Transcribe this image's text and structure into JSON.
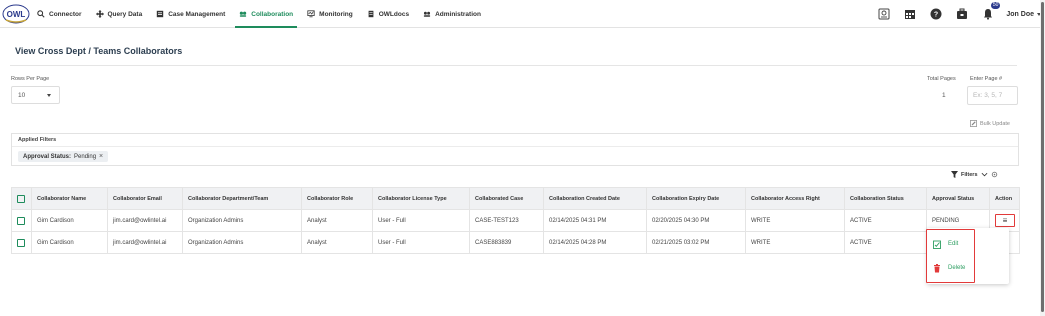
{
  "header": {
    "logo_text": "OWL",
    "nav": [
      {
        "label": "Connector",
        "icon": "search-icon"
      },
      {
        "label": "Query Data",
        "icon": "move-icon"
      },
      {
        "label": "Case Management",
        "icon": "folder-icon"
      },
      {
        "label": "Collaboration",
        "icon": "collaboration-icon",
        "active": true
      },
      {
        "label": "Monitoring",
        "icon": "monitor-icon"
      },
      {
        "label": "OWLdocs",
        "icon": "docs-icon"
      },
      {
        "label": "Administration",
        "icon": "admin-icon"
      }
    ],
    "notification_count": "50",
    "user_name": "Jon Doe"
  },
  "page": {
    "title": "View Cross Dept / Teams Collaborators",
    "rows_per_page_label": "Rows Per Page",
    "rows_per_page_value": "10",
    "total_pages_label": "Total Pages",
    "total_pages_value": "1",
    "enter_page_label": "Enter Page #",
    "enter_page_placeholder": "Ex: 3, 5, 7",
    "bulk_update_label": "Bulk Update",
    "applied_filters_label": "Applied Filters",
    "filter_chip_key": "Approval Status:",
    "filter_chip_value": "Pending",
    "filters_button_label": "Filters"
  },
  "table": {
    "headers": [
      "Collaborator Name",
      "Collaborator Email",
      "Collaborator Department/Team",
      "Collaborator Role",
      "Collaborator License Type",
      "Collaborated Case",
      "Collaboration Created Date",
      "Collaboration Expiry Date",
      "Collaborator Access Right",
      "Collaboration Status",
      "Approval Status",
      "Action"
    ],
    "rows": [
      [
        "Gim Cardison",
        "jim.card@owlintel.ai",
        "Organization Admins",
        "Analyst",
        "User - Full",
        "CASE-TEST123",
        "02/14/2025 04:31 PM",
        "02/20/2025 04:30 PM",
        "WRITE",
        "ACTIVE",
        "PENDING"
      ],
      [
        "Gim Cardison",
        "jim.card@owlintel.ai",
        "Organization Admins",
        "Analyst",
        "User - Full",
        "CASE883839",
        "02/14/2025 04:28 PM",
        "02/21/2025 03:02 PM",
        "WRITE",
        "ACTIVE",
        ""
      ]
    ]
  },
  "action_menu": {
    "edit_label": "Edit",
    "delete_label": "Delete"
  },
  "colors": {
    "accent": "#1e8c5c",
    "highlight": "#e23a3a",
    "title": "#2c3e50"
  }
}
